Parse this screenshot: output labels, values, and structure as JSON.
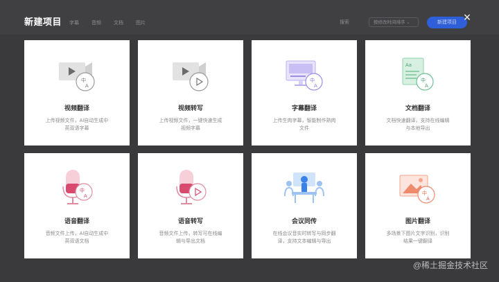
{
  "background": {
    "tabs": [
      "字幕",
      "音频",
      "文档",
      "图片"
    ],
    "search_label": "搜索",
    "sort_label": "按修改时间排序",
    "new_button_label": "新建项目"
  },
  "dialog": {
    "title": "新建项目",
    "close_icon": "×",
    "cards": [
      {
        "title": "视频翻译",
        "desc": "上传视频文件，AI自动生成中英双语字幕",
        "icon": "video-translate-icon"
      },
      {
        "title": "视频转写",
        "desc": "上传视频文件，一键快速生成视频字幕",
        "icon": "video-transcribe-icon"
      },
      {
        "title": "字幕翻译",
        "desc": "上传生肉字幕，智能制作熟肉文件",
        "icon": "subtitle-translate-icon"
      },
      {
        "title": "文档翻译",
        "desc": "文档快速翻译，支持在线编辑与本地导出",
        "icon": "document-translate-icon"
      },
      {
        "title": "语音翻译",
        "desc": "音频文件上传，AI自动生成中英双语文档",
        "icon": "voice-translate-icon"
      },
      {
        "title": "语音转写",
        "desc": "音频文件上传，转写可在线编辑与导出文档",
        "icon": "voice-transcribe-icon"
      },
      {
        "title": "会议同传",
        "desc": "在线会议音实时转写与同步翻译，支持文本编辑与导出",
        "icon": "meeting-interpret-icon"
      },
      {
        "title": "图片翻译",
        "desc": "多场景下图片文字识别，识别结果一键翻译",
        "icon": "image-translate-icon"
      }
    ]
  },
  "watermark": "@稀土掘金技术社区"
}
